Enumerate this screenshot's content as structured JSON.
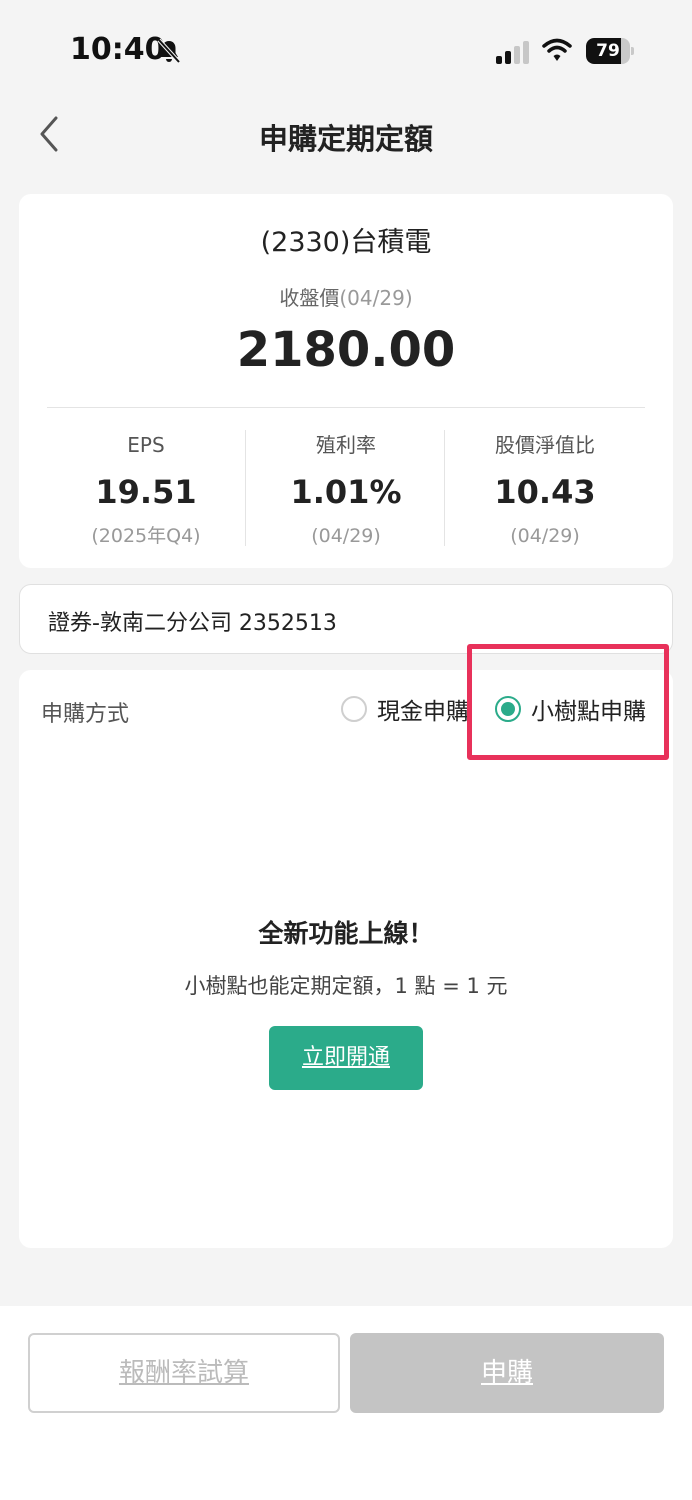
{
  "status_bar": {
    "time": "10:40",
    "battery_level": 79,
    "battery_text": "79"
  },
  "nav": {
    "title": "申購定期定額"
  },
  "stock": {
    "name": "(2330)台積電",
    "close_label": "收盤價",
    "close_date": "(04/29)",
    "close_price": "2180.00",
    "metrics": [
      {
        "label": "EPS",
        "value": "19.51",
        "sub": "(2025年Q4)"
      },
      {
        "label": "殖利率",
        "value": "1.01%",
        "sub": "(04/29)"
      },
      {
        "label": "股價淨值比",
        "value": "10.43",
        "sub": "(04/29)"
      }
    ]
  },
  "account": {
    "text": "證券-敦南二分公司 2352513"
  },
  "method": {
    "label": "申購方式",
    "options": [
      {
        "label": "現金申購",
        "selected": false
      },
      {
        "label": "小樹點申購",
        "selected": true
      }
    ],
    "highlight_color": "#e8315a"
  },
  "promo": {
    "title": "全新功能上線！",
    "subtitle": "小樹點也能定期定額，1 點 = 1 元",
    "button_label": "立即開通"
  },
  "bottom": {
    "calc_label": "報酬率試算",
    "apply_label": "申購"
  },
  "colors": {
    "accent": "#2bab8a",
    "disabled": "#c4c4c4"
  },
  "icons": [
    "bell-muted-icon",
    "cellular-signal-icon",
    "wifi-icon",
    "battery-icon",
    "chevron-left-icon"
  ]
}
